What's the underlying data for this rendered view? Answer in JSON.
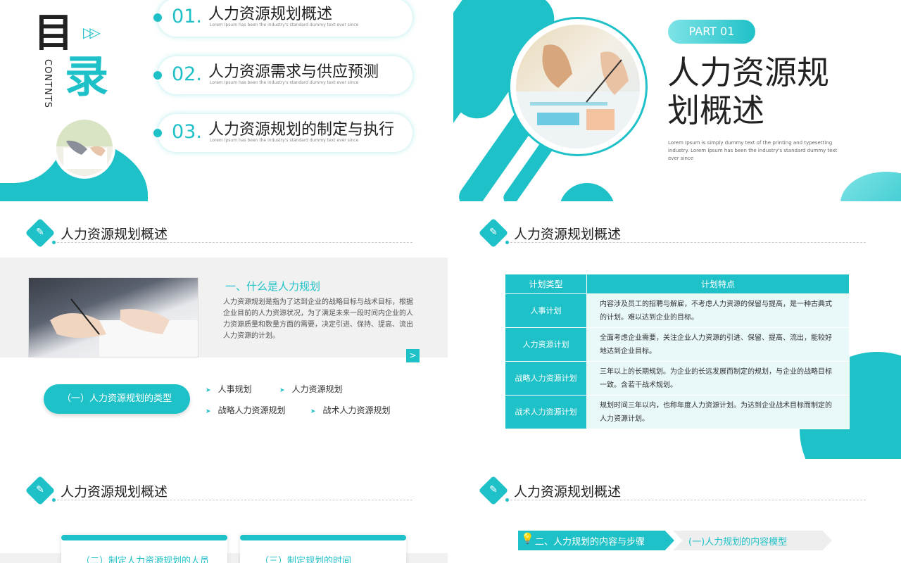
{
  "slide1": {
    "mu": "目",
    "lu": "录",
    "contnts": "CONTNTS",
    "toc": [
      {
        "num": "01.",
        "title": "人力资源规划概述",
        "sub": "Lorem Ipsum has been the industry's standard dummy text ever since"
      },
      {
        "num": "02.",
        "title": "人力资源需求与供应预测",
        "sub": "Lorem Ipsum has been the industry's standard dummy text ever since"
      },
      {
        "num": "03.",
        "title": "人力资源规划的制定与执行",
        "sub": "Lorem Ipsum has been the industry's standard dummy text ever since"
      }
    ]
  },
  "slide2": {
    "part": "PART 01",
    "title": "人力资源规划概述",
    "desc": "Lorem Ipsum is simply dummy text of the printing and typesetting industry. Lorem Ipsum has been the industry's standard dummy text ever since"
  },
  "slide3": {
    "header": "人力资源规划概述",
    "heading": "一、什么是人力规划",
    "paragraph": "人力资源规划是指为了达到企业的战略目标与战术目标，根据企业目前的人力资源状况，为了满足未来一段时间内企业的人力资源质量和数量方面的需要，决定引进、保持、提高、流出人力资源的计划。",
    "arrow": ">",
    "pill": "（一）人力资源规划的类型",
    "types": [
      "人事规划",
      "人力资源规划",
      "战略人力资源规划",
      "战术人力资源规划"
    ],
    "bullet": "➤"
  },
  "slide4": {
    "header": "人力资源规划概述",
    "table": {
      "head": [
        "计划类型",
        "计划特点"
      ],
      "rows": [
        {
          "type": "人事计划",
          "desc": "内容涉及员工的招聘与解雇，不考虑人力资源的保留与提高，是一种古典式的计划。难以达到企业的目标。"
        },
        {
          "type": "人力资源计划",
          "desc": "全面考虑企业需要，关注企业人力资源的引进、保留、提高、流出，能较好地达到企业目标。"
        },
        {
          "type": "战略人力资源计划",
          "desc": "三年以上的长期规划。为企业的长远发展而制定的规划，与企业的战略目标一致。含若干战术规划。"
        },
        {
          "type": "战术人力资源计划",
          "desc": "规划时间三年以内，也称年度人力资源计划。为达到企业战术目标而制定的人力资源计划。"
        }
      ]
    }
  },
  "slide5": {
    "header": "人力资源规划概述",
    "cards": [
      "（二）制定人力资源规划的人员",
      "（三）制定规划的时间"
    ]
  },
  "slide6": {
    "header": "人力资源规划概述",
    "step1": "二、人力规划的内容与步骤",
    "step2": "(一)人力规划的内容模型"
  },
  "colors": {
    "accent": "#1fc1c8",
    "light": "#e9f8f9"
  },
  "icons": {
    "play": "play-icon",
    "edit": "edit-icon",
    "bulb": "bulb-icon"
  }
}
